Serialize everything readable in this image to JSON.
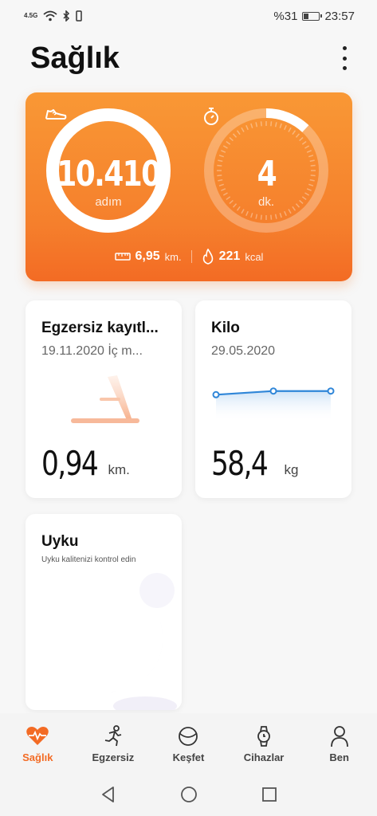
{
  "status_bar": {
    "network": "4.5G",
    "battery_percent": "%31",
    "battery_level": 0.31,
    "time": "23:57"
  },
  "header": {
    "title": "Sağlık",
    "menu_icon": "more-vert-icon"
  },
  "activity": {
    "steps_value": "10.410",
    "steps_unit": "adım",
    "steps_progress": 1.0,
    "active_minutes_value": "4",
    "active_minutes_unit": "dk.",
    "active_minutes_progress": 0.12,
    "distance_value": "6,95",
    "distance_unit": "km.",
    "calories_value": "221",
    "calories_unit": "kcal"
  },
  "exercise_card": {
    "title": "Egzersiz kayıtl...",
    "subtitle": "19.11.2020 İç m...",
    "value": "0,94",
    "unit": "km.",
    "icon": "treadmill-icon"
  },
  "weight_card": {
    "title": "Kilo",
    "subtitle": "29.05.2020",
    "value": "58,4",
    "unit": "kg",
    "chart_points": [
      58.3,
      58.4,
      58.4
    ]
  },
  "sleep_card": {
    "title": "Uyku",
    "subtitle": "Uyku kalitenizi kontrol edin",
    "icon": "moon-icon"
  },
  "bottom_nav": {
    "items": [
      {
        "label": "Sağlık",
        "icon": "heart-pulse-icon",
        "active": true
      },
      {
        "label": "Egzersiz",
        "icon": "running-icon",
        "active": false
      },
      {
        "label": "Keşfet",
        "icon": "explore-icon",
        "active": false
      },
      {
        "label": "Cihazlar",
        "icon": "watch-icon",
        "active": false
      },
      {
        "label": "Ben",
        "icon": "person-icon",
        "active": false
      }
    ]
  },
  "colors": {
    "accent": "#f36b24",
    "chart_line": "#2f86d8"
  }
}
